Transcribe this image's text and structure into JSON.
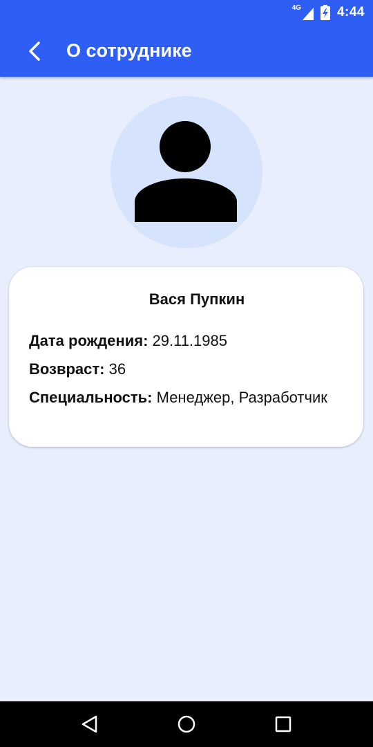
{
  "status_bar": {
    "network_label": "4G",
    "time": "4:44"
  },
  "app_bar": {
    "title": "О сотруднике",
    "back_icon": "arrow-back-icon",
    "color": "#2f5ef5"
  },
  "profile": {
    "avatar_icon": "person-icon",
    "name": "Вася Пупкин",
    "birth_label": "Дата рождения:",
    "birth_value": "29.11.1985",
    "age_label": "Возвраст:",
    "age_value": "36",
    "specialty_label": "Специальность:",
    "specialty_value": "Менеджер, Разработчик"
  },
  "nav_bar": {
    "back_icon": "nav-back-icon",
    "home_icon": "nav-home-icon",
    "recents_icon": "nav-recents-icon"
  }
}
